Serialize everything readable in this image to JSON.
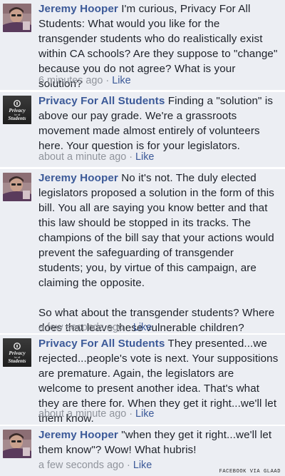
{
  "comments": [
    {
      "author": "Jeremy Hooper",
      "text": "I'm curious, Privacy For All Students: What would you like for the transgender students who do realistically exist within CA schools? Are they suppose to \"change\" because you do not agree? What is your solution?",
      "text2": "",
      "time": "6 minutes ago",
      "separator": "·",
      "like": "Like"
    },
    {
      "author": "Privacy For All Students",
      "text": "Finding a \"solution\" is above our pay grade. We're a grassroots movement made almost entirely of volunteers here. Your question is for your legislators.",
      "text2": "",
      "time": "about a minute ago",
      "separator": "·",
      "like": "Like"
    },
    {
      "author": "Jeremy Hooper",
      "text": "No it's not. The duly elected legislators proposed a solution in the form of this bill. You all are saying you know better and that this law should be stopped in its tracks. The champions of the bill say that your actions would prevent the safeguarding of transgender students; you, by virtue of this campaign, are claiming the opposite.",
      "text2": "So what about the transgender students? Where does that leave these vulnerable children?",
      "time": "a few seconds ago",
      "separator": "·",
      "like": "Like"
    },
    {
      "author": "Privacy For All Students",
      "text": "They presented...we rejected...people's vote is next. Your suppositions are premature. Again, the legislators are welcome to present another idea. That's what they are there for. When they get it right...we'll let them know.",
      "text2": "",
      "time": "about a minute ago",
      "separator": "·",
      "like": "Like"
    },
    {
      "author": "Jeremy Hooper",
      "text": "\"when they get it right...we'll let them know\"? Wow! What hubris!",
      "text2": "",
      "time": "a few seconds ago",
      "separator": "·",
      "like": "Like"
    }
  ],
  "logo_text": "Privacy for all Students",
  "credit": "FACEBOOK VIA GLAAD",
  "colors": {
    "author": "#3b5998",
    "meta": "#90949c",
    "card_bg": "#eceef3"
  }
}
